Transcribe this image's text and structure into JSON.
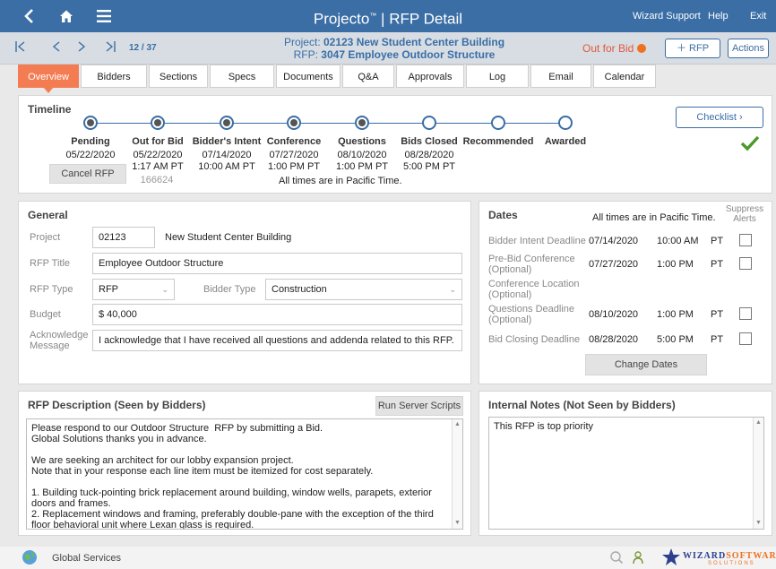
{
  "topbar": {
    "title": "Projecto",
    "trademark": "™",
    "separator": "|",
    "subtitle": "RFP Detail",
    "links": [
      "Wizard Support",
      "Help",
      "Exit"
    ]
  },
  "nav": {
    "record": "12 / 37",
    "project_prefix": "Project: ",
    "project_value": "02123 New Student Center Building",
    "rfp_prefix": "RFP: ",
    "rfp_value": "3047 Employee Outdoor Structure",
    "status": "Out for Bid",
    "add_rfp": "＋ RFP",
    "actions": "Actions"
  },
  "tabs": [
    "Overview",
    "Bidders",
    "Sections",
    "Specs",
    "Documents",
    "Q&A",
    "Approvals",
    "Log",
    "Email",
    "Calendar"
  ],
  "timeline": {
    "title": "Timeline",
    "checklist": "Checklist ›",
    "stages": [
      {
        "label": "Pending",
        "date": "05/22/2020",
        "time": "",
        "done": true
      },
      {
        "label": "Out for Bid",
        "date": "05/22/2020",
        "time": "1:17 AM  PT",
        "done": true
      },
      {
        "label": "Bidder's Intent",
        "date": "07/14/2020",
        "time": "10:00 AM  PT",
        "done": true
      },
      {
        "label": "Conference",
        "date": "07/27/2020",
        "time": "1:00 PM  PT",
        "done": true
      },
      {
        "label": "Questions",
        "date": "08/10/2020",
        "time": "1:00 PM  PT",
        "done": true
      },
      {
        "label": "Bids Closed",
        "date": "08/28/2020",
        "time": "5:00 PM  PT",
        "done": false
      },
      {
        "label": "Recommended",
        "date": "",
        "time": "",
        "done": false
      },
      {
        "label": "Awarded",
        "date": "",
        "time": "",
        "done": false
      }
    ],
    "cancel": "Cancel RFP",
    "ref_number": "166624",
    "tz_note": "All times are in Pacific Time."
  },
  "general": {
    "title": "General",
    "project_label": "Project",
    "project_number": "02123",
    "project_name": "New Student Center Building",
    "rfp_title_label": "RFP Title",
    "rfp_title": "Employee Outdoor Structure",
    "rfp_type_label": "RFP Type",
    "rfp_type": "RFP",
    "bidder_type_label": "Bidder Type",
    "bidder_type": "Construction",
    "budget_label": "Budget",
    "budget": "$ 40,000",
    "ack_label_1": "Acknowledge",
    "ack_label_2": "Message",
    "ack_message": "I acknowledge that I have received all questions and addenda related to this RFP."
  },
  "dates": {
    "title": "Dates",
    "tz_note": "All times are in Pacific Time.",
    "suppress_1": "Suppress",
    "suppress_2": "Alerts",
    "rows": [
      {
        "label1": "Bidder Intent Deadline",
        "label2": "",
        "date": "07/14/2020",
        "time": "10:00 AM",
        "tz": "PT",
        "checkbox": true
      },
      {
        "label1": "Pre-Bid Conference",
        "label2": "(Optional)",
        "date": "07/27/2020",
        "time": "1:00 PM",
        "tz": "PT",
        "checkbox": true
      },
      {
        "label1": "Conference Location",
        "label2": "(Optional)",
        "date": "",
        "time": "",
        "tz": "",
        "checkbox": false
      },
      {
        "label1": "Questions Deadline",
        "label2": "(Optional)",
        "date": "08/10/2020",
        "time": "1:00 PM",
        "tz": "PT",
        "checkbox": true
      },
      {
        "label1": "Bid Closing Deadline",
        "label2": "",
        "date": "08/28/2020",
        "time": "5:00 PM",
        "tz": "PT",
        "checkbox": true
      }
    ],
    "change_dates": "Change Dates"
  },
  "description": {
    "title": "RFP Description (Seen by Bidders)",
    "run_scripts": "Run Server Scripts",
    "text": "Please respond to our Outdoor Structure  RFP by submitting a Bid.\nGlobal Solutions thanks you in advance.\n\nWe are seeking an architect for our lobby expansion project.\nNote that in your response each line item must be itemized for cost separately.\n\n1. Building tuck-pointing brick replacement around building, window wells, parapets, exterior doors and frames.\n2. Replacement windows and framing, preferably double-pane with the exception of the third floor behavioral unit where Lexan glass is required."
  },
  "notes": {
    "title": "Internal Notes (Not Seen by Bidders)",
    "text": "This RFP is top priority"
  },
  "footer": {
    "company": "Global Services",
    "brand": "WIZARD",
    "brand_2": "SOFTWARE",
    "brand_sub": "SOLUTIONS"
  },
  "colors": {
    "topbar": "#3a6ea5",
    "accent": "#f47c52",
    "status": "#e05a3a",
    "check": "#4a9a2a"
  }
}
